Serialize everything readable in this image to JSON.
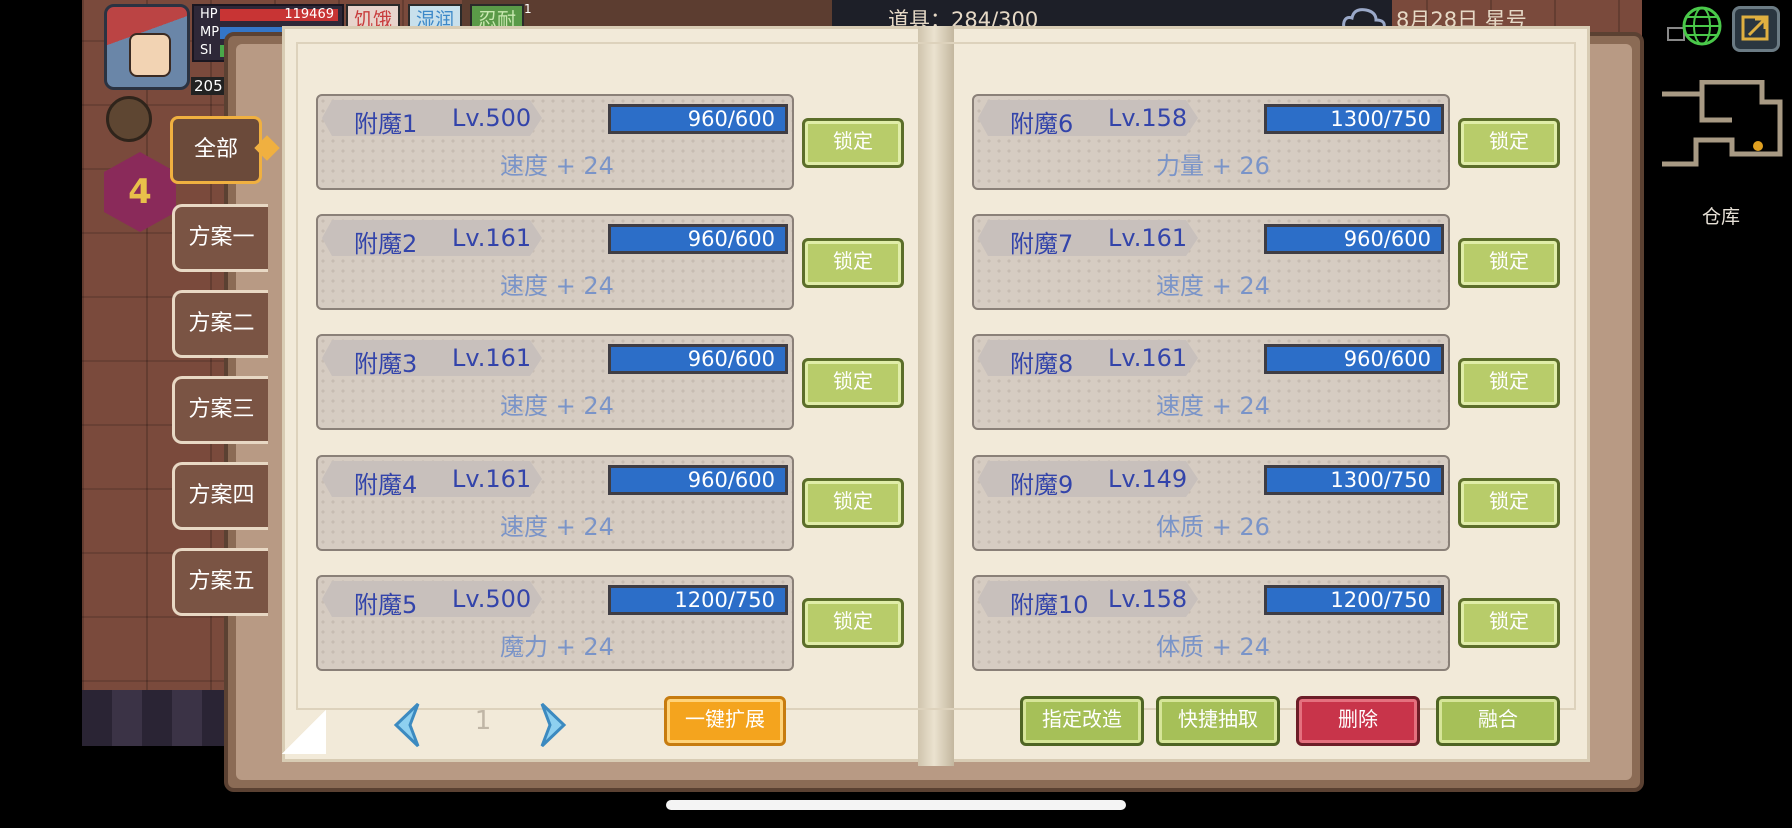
{
  "hud": {
    "hp_label": "HP",
    "hp_value": "119469",
    "mp_label": "MP",
    "sp_label": "SI",
    "player_level": "205",
    "status_tags": [
      "饥饿",
      "湿润",
      "忍耐"
    ],
    "status_badge": "1",
    "items_count": "道具：284/300",
    "date": "8月28日 星号",
    "energy_value": "4",
    "warehouse_label": "仓库"
  },
  "tabs": [
    {
      "label": "全部",
      "active": true
    },
    {
      "label": "方案一"
    },
    {
      "label": "方案二"
    },
    {
      "label": "方案三"
    },
    {
      "label": "方案四"
    },
    {
      "label": "方案五"
    }
  ],
  "slots": [
    {
      "name": "附魔1",
      "level": "Lv.500",
      "progress": "960/600",
      "stat": "速度 + 24",
      "lock": "锁定"
    },
    {
      "name": "附魔2",
      "level": "Lv.161",
      "progress": "960/600",
      "stat": "速度 + 24",
      "lock": "锁定"
    },
    {
      "name": "附魔3",
      "level": "Lv.161",
      "progress": "960/600",
      "stat": "速度 + 24",
      "lock": "锁定"
    },
    {
      "name": "附魔4",
      "level": "Lv.161",
      "progress": "960/600",
      "stat": "速度 + 24",
      "lock": "锁定"
    },
    {
      "name": "附魔5",
      "level": "Lv.500",
      "progress": "1200/750",
      "stat": "魔力 + 24",
      "lock": "锁定"
    },
    {
      "name": "附魔6",
      "level": "Lv.158",
      "progress": "1300/750",
      "stat": "力量 + 26",
      "lock": "锁定"
    },
    {
      "name": "附魔7",
      "level": "Lv.161",
      "progress": "960/600",
      "stat": "速度 + 24",
      "lock": "锁定"
    },
    {
      "name": "附魔8",
      "level": "Lv.161",
      "progress": "960/600",
      "stat": "速度 + 24",
      "lock": "锁定"
    },
    {
      "name": "附魔9",
      "level": "Lv.149",
      "progress": "1300/750",
      "stat": "体质 + 26",
      "lock": "锁定"
    },
    {
      "name": "附魔10",
      "level": "Lv.158",
      "progress": "1200/750",
      "stat": "体质 + 24",
      "lock": "锁定"
    }
  ],
  "pager": {
    "page": "1",
    "prev_icon": "chevron-left-icon",
    "next_icon": "chevron-right-icon"
  },
  "buttons": {
    "expand": "一键扩展",
    "reforge": "指定改造",
    "quick_extract": "快捷抽取",
    "delete": "删除",
    "merge": "融合"
  },
  "colors": {
    "progress_bar": "#2c6ec8",
    "lock_button": "#b8cc6a",
    "delete_button": "#c8344a",
    "expand_button": "#f4a41e",
    "active_tab_border": "#f0b040",
    "slot_name_text": "#3344aa",
    "stat_text": "#7a94c8"
  }
}
